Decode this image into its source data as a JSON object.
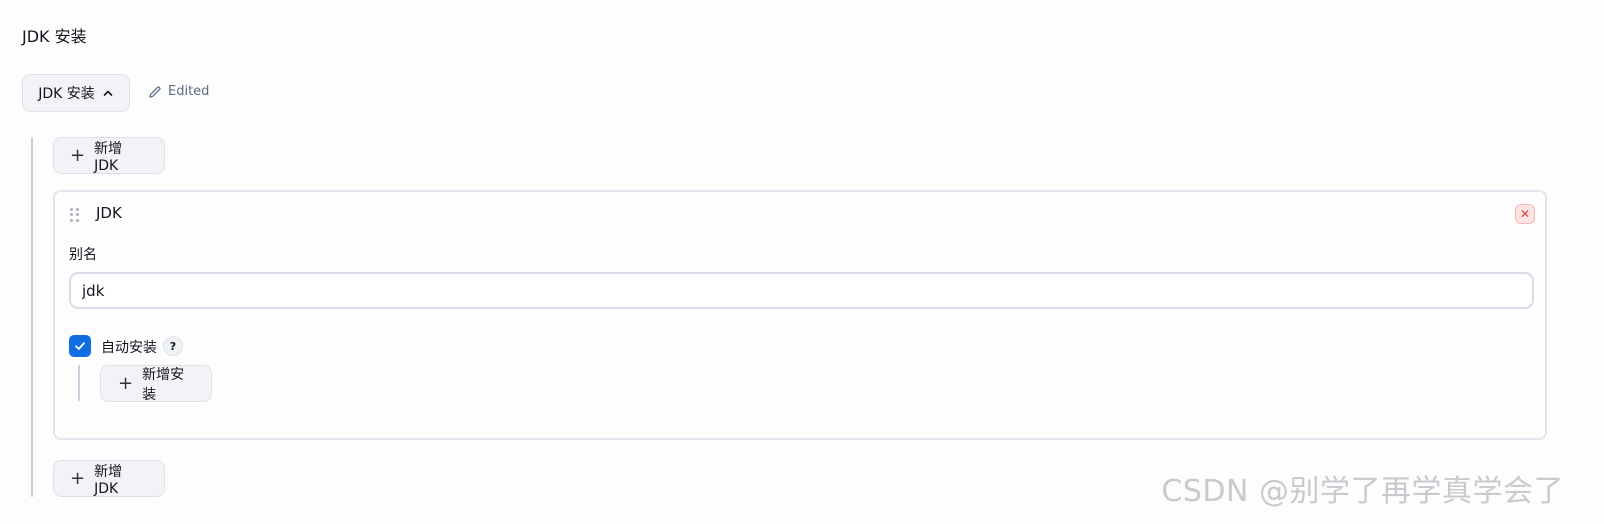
{
  "section": {
    "title": "JDK 安装"
  },
  "toggle": {
    "label": "JDK 安装",
    "icon": "chevron-up-icon"
  },
  "status": {
    "edited_label": "Edited",
    "icon": "pencil-icon"
  },
  "add_jdk_label": "新增 JDK",
  "jdk_card": {
    "title": "JDK",
    "alias_label": "别名",
    "alias_value": "jdk",
    "auto_install_label": "自动安装",
    "auto_install_checked": true,
    "help_symbol": "?",
    "add_install_label": "新增安装",
    "close_symbol": "✕"
  },
  "watermark": "CSDN @别学了再学真学会了",
  "colors": {
    "accent": "#0f6fe0",
    "danger": "#e23b3b",
    "rail": "#c6cedc"
  }
}
